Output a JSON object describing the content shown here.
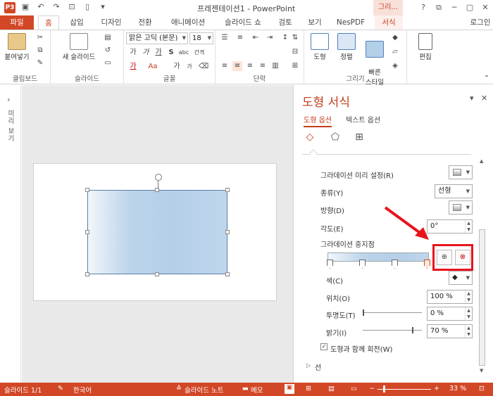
{
  "titlebar": {
    "app_icon": "P3",
    "title": "프레젠테이션1 - PowerPoint",
    "context_title": "그리...",
    "buttons": [
      "?",
      "⧉",
      "─",
      "▢",
      "✕"
    ]
  },
  "tabs": [
    {
      "label": "파일"
    },
    {
      "label": "홈"
    },
    {
      "label": "삽입"
    },
    {
      "label": "디자인"
    },
    {
      "label": "전환"
    },
    {
      "label": "애니메이션"
    },
    {
      "label": "슬라이드 쇼"
    },
    {
      "label": "검토"
    },
    {
      "label": "보기"
    },
    {
      "label": "NesPDF"
    },
    {
      "label": "서식"
    },
    {
      "label": "로그인"
    }
  ],
  "ribbon": {
    "clipboard": {
      "paste": "붙여넣기",
      "label": "클립보드"
    },
    "slides": {
      "new_slide": "새 슬라이드",
      "label": "슬라이드"
    },
    "font": {
      "font_name": "맑은 고딕 (본문)",
      "font_size": "18",
      "label": "글꼴",
      "grow": "가",
      "shrink": "가",
      "clear": "가",
      "bold": "가",
      "italic": "가",
      "underline": "가",
      "strike": "S",
      "shadow": "abc",
      "spacing": "간격",
      "case": "Aa",
      "color": "가"
    },
    "paragraph": {
      "label": "단락"
    },
    "drawing": {
      "shapes": "도형",
      "arrange": "정렬",
      "quick_styles": "빠른\n스타일",
      "label": "그리기"
    },
    "editing": {
      "edit": "편집"
    }
  },
  "left_rail": {
    "text": "미리 보기"
  },
  "format_pane": {
    "title": "도형 서식",
    "tab_shape": "도형 옵션",
    "tab_text": "텍스트 옵션",
    "preset_label": "그라데이션 미리 설정(R)",
    "type_label": "종류(Y)",
    "type_value": "선형",
    "direction_label": "방향(D)",
    "angle_label": "각도(E)",
    "angle_value": "0°",
    "stops_label": "그라데이션 중지점",
    "color_label": "색(C)",
    "position_label": "위치(O)",
    "position_value": "100 %",
    "transparency_label": "투명도(T)",
    "transparency_value": "0 %",
    "brightness_label": "밝기(I)",
    "brightness_value": "70 %",
    "rotate_label": "도형과 함께 회전(W)",
    "line_label": "선"
  },
  "status": {
    "slide": "슬라이드 1/1",
    "lang": "한국어",
    "notes": "슬라이드 노트",
    "comments": "메모",
    "zoom": "33 %"
  },
  "colors": {
    "accent": "#d24726",
    "highlight": "#e8141c"
  }
}
